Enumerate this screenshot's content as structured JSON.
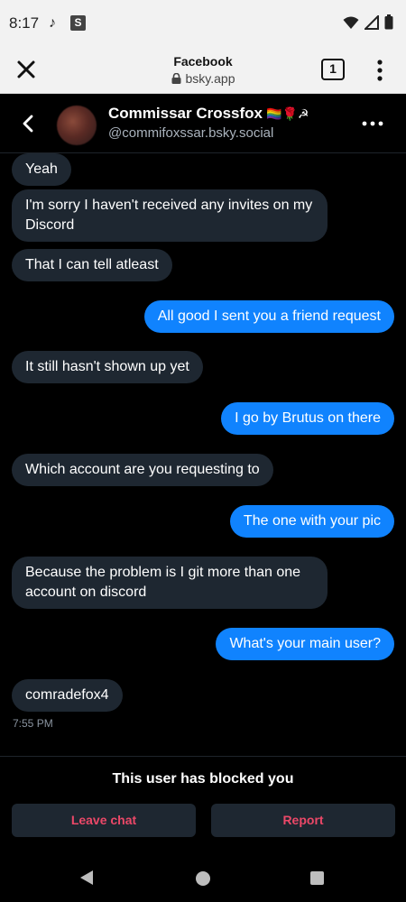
{
  "status_bar": {
    "time": "8:17",
    "app_icons": [
      "tiktok-icon",
      "s-icon"
    ],
    "s_icon_text": "S",
    "right_icons": [
      "wifi-icon",
      "signal-icon",
      "battery-icon"
    ]
  },
  "browser": {
    "title": "Facebook",
    "url": "bsky.app",
    "tab_count": "1",
    "icons": [
      "close-icon",
      "lock-icon",
      "more-vertical-icon"
    ]
  },
  "chat_header": {
    "name": "Commissar Crossfox",
    "name_emojis": "🏳️‍🌈🌹☭",
    "handle": "@commifoxssar.bsky.social",
    "icons": [
      "back-icon",
      "more-horizontal-icon"
    ]
  },
  "messages": [
    {
      "dir": "in",
      "text": "Yeah"
    },
    {
      "dir": "in",
      "text": "I'm sorry I haven't received any invites on my Discord"
    },
    {
      "dir": "in",
      "text": "That I can tell atleast"
    },
    {
      "dir": "out",
      "text": "All good I sent you a friend request"
    },
    {
      "dir": "in",
      "text": "It still hasn't shown up yet"
    },
    {
      "dir": "out",
      "text": "I go by Brutus on there"
    },
    {
      "dir": "in",
      "text": "Which account are you requesting to"
    },
    {
      "dir": "out",
      "text": "The one with your pic"
    },
    {
      "dir": "in",
      "text": "Because the problem is I git more than one account on discord"
    },
    {
      "dir": "out",
      "text": "What's your main user?"
    },
    {
      "dir": "in",
      "text": "comradefox4"
    }
  ],
  "last_timestamp": "7:55 PM",
  "footer": {
    "blocked_text": "This user has blocked you",
    "leave_label": "Leave chat",
    "report_label": "Report"
  },
  "colors": {
    "incoming_bubble": "#1e2731",
    "outgoing_bubble": "#1083fe",
    "danger_text": "#ec4868",
    "background": "#000000"
  },
  "nav_bar": {
    "icons": [
      "nav-back-icon",
      "nav-home-icon",
      "nav-recents-icon"
    ]
  }
}
